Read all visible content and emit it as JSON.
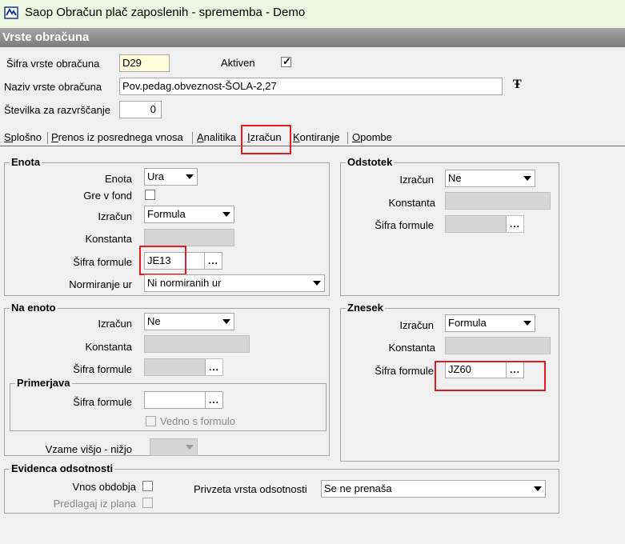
{
  "window": {
    "title": "Saop Obračun plač zaposlenih - sprememba - Demo",
    "icon": "app-icon"
  },
  "header": {
    "title": "Vrste obračuna"
  },
  "top": {
    "sifra_label": "Šifra vrste obračuna",
    "sifra_value": "D29",
    "aktiven_label": "Aktiven",
    "aktiven_checked": true,
    "naziv_label": "Naziv vrste obračuna",
    "naziv_value": "Pov.pedag.obveznost-ŠOLA-2,27",
    "stevilka_label": "Številka  za razvrščanje",
    "stevilka_value": "0"
  },
  "tabs": [
    {
      "prefix": "",
      "u": "S",
      "rest": "plošno"
    },
    {
      "prefix": "",
      "u": "P",
      "rest": "renos iz posrednega vnosa"
    },
    {
      "prefix": "",
      "u": "A",
      "rest": "nalitika"
    },
    {
      "prefix": "",
      "u": "I",
      "rest": "zračun"
    },
    {
      "prefix": "",
      "u": "K",
      "rest": "ontiranje"
    },
    {
      "prefix": "",
      "u": "O",
      "rest": "pombe"
    }
  ],
  "active_tab": "Izračun",
  "enota": {
    "title": "Enota",
    "enota_label": "Enota",
    "enota_value": "Ura",
    "gre_label": "Gre v fond",
    "izracun_label": "Izračun",
    "izracun_value": "Formula",
    "konstanta_label": "Konstanta",
    "sifra_label": "Šifra formule",
    "sifra_value": "JE13",
    "norm_label": "Normiranje ur",
    "norm_value": "Ni normiranih ur"
  },
  "odstotek": {
    "title": "Odstotek",
    "izracun_label": "Izračun",
    "izracun_value": "Ne",
    "konstanta_label": "Konstanta",
    "sifra_label": "Šifra formule"
  },
  "na_enoto": {
    "title": "Na enoto",
    "izracun_label": "Izračun",
    "izracun_value": "Ne",
    "konstanta_label": "Konstanta",
    "sifra_label": "Šifra formule",
    "primerjava_title": "Primerjava",
    "prim_sifra_label": "Šifra formule",
    "vedno_label": "Vedno s formulo",
    "vzame_label": "Vzame višjo - nižjo"
  },
  "znesek": {
    "title": "Znesek",
    "izracun_label": "Izračun",
    "izracun_value": "Formula",
    "konstanta_label": "Konstanta",
    "sifra_label": "Šifra formule",
    "sifra_value": "JZ60"
  },
  "evidenca": {
    "title": "Evidenca odsotnosti",
    "vnos_label": "Vnos obdobja",
    "predlagaj_label": "Predlagaj iz plana",
    "privzeta_label": "Privzeta vrsta odsotnosti",
    "privzeta_value": "Se ne prenaša"
  },
  "lookup_button_label": "...",
  "highlight_color": "#dd1f1f"
}
